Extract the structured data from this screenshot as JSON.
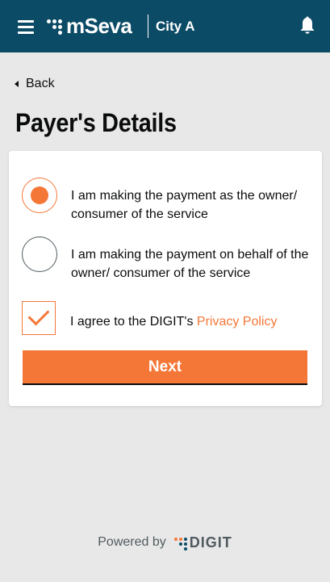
{
  "header": {
    "menu_icon": "hamburger-icon",
    "logo_text": "mSeva",
    "city": "City A",
    "notification_icon": "bell-icon",
    "bg_color": "#0b4b66"
  },
  "nav": {
    "back_icon": "caret-left-icon",
    "back_label": "Back"
  },
  "page": {
    "title": "Payer's Details"
  },
  "form": {
    "options": [
      {
        "label": "I am making the payment as the owner/ consumer of the service",
        "selected": true
      },
      {
        "label": "I am making the payment on behalf of the owner/ consumer of the service",
        "selected": false
      }
    ],
    "agree_text": "I agree to the DIGIT's ",
    "privacy_link": "Privacy Policy",
    "agree_checked": true,
    "next_label": "Next",
    "accent_color": "#f47738"
  },
  "footer": {
    "powered_by": "Powered by",
    "brand": "DIGIT"
  }
}
